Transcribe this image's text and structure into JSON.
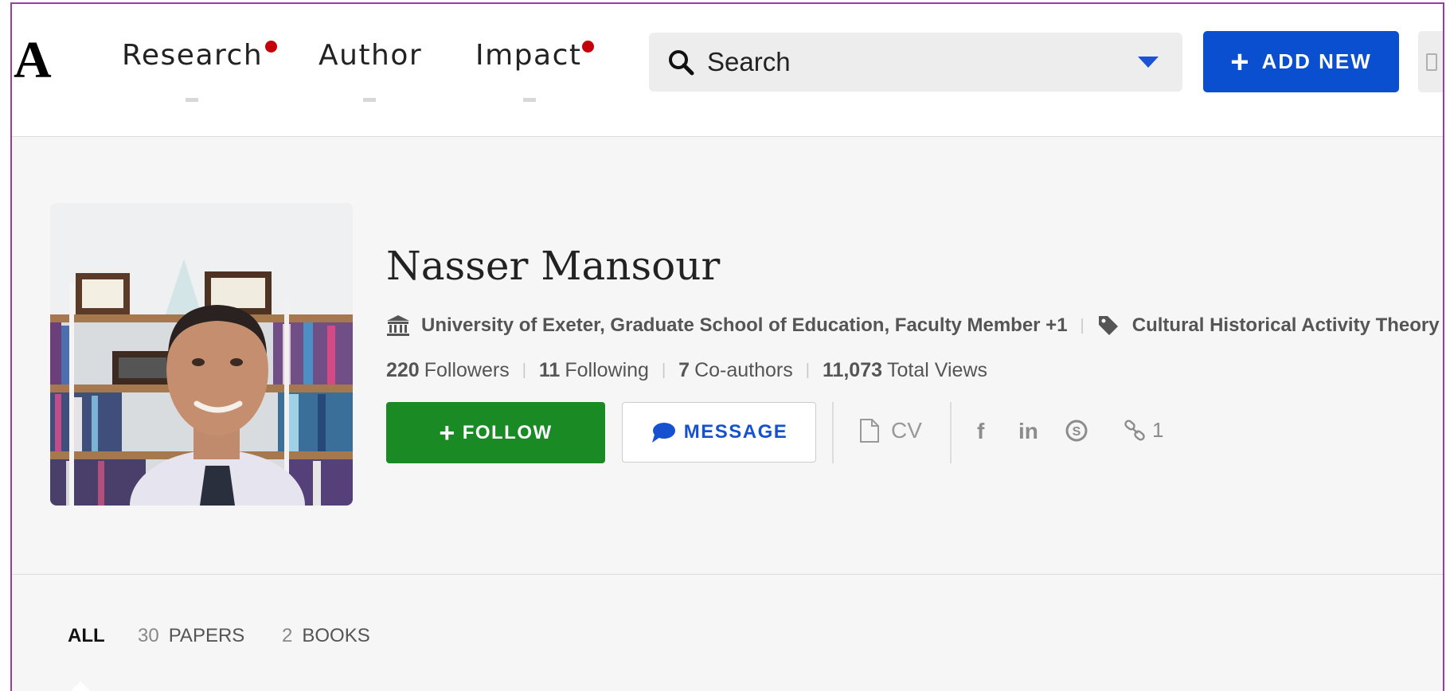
{
  "header": {
    "logo": "A",
    "nav": [
      {
        "label": "Research",
        "has_dot": true
      },
      {
        "label": "Author",
        "has_dot": false
      },
      {
        "label": "Impact",
        "has_dot": true
      }
    ],
    "search": {
      "placeholder": "Search"
    },
    "add_new_label": "ADD NEW"
  },
  "profile": {
    "name": "Nasser Mansour",
    "affiliation": "University of Exeter, Graduate School of Education, Faculty Member +1",
    "research_interest": "Cultural Historical Activity Theory +",
    "stats": [
      {
        "value": "220",
        "label": "Followers"
      },
      {
        "value": "11",
        "label": "Following"
      },
      {
        "value": "7",
        "label": "Co-authors"
      },
      {
        "value": "11,073",
        "label": "Total Views"
      }
    ],
    "follow_label": "FOLLOW",
    "message_label": "MESSAGE",
    "cv_label": "CV",
    "social_icons": [
      "facebook-icon",
      "linkedin-icon",
      "skype-icon"
    ],
    "link_count": "1"
  },
  "tabs": [
    {
      "count": "",
      "label": "ALL",
      "active": true
    },
    {
      "count": "30",
      "label": "PAPERS",
      "active": false
    },
    {
      "count": "2",
      "label": "BOOKS",
      "active": false
    }
  ],
  "colors": {
    "accent_blue": "#0a4fd0",
    "follow_green": "#1a8a24",
    "notification_red": "#c5000b"
  }
}
